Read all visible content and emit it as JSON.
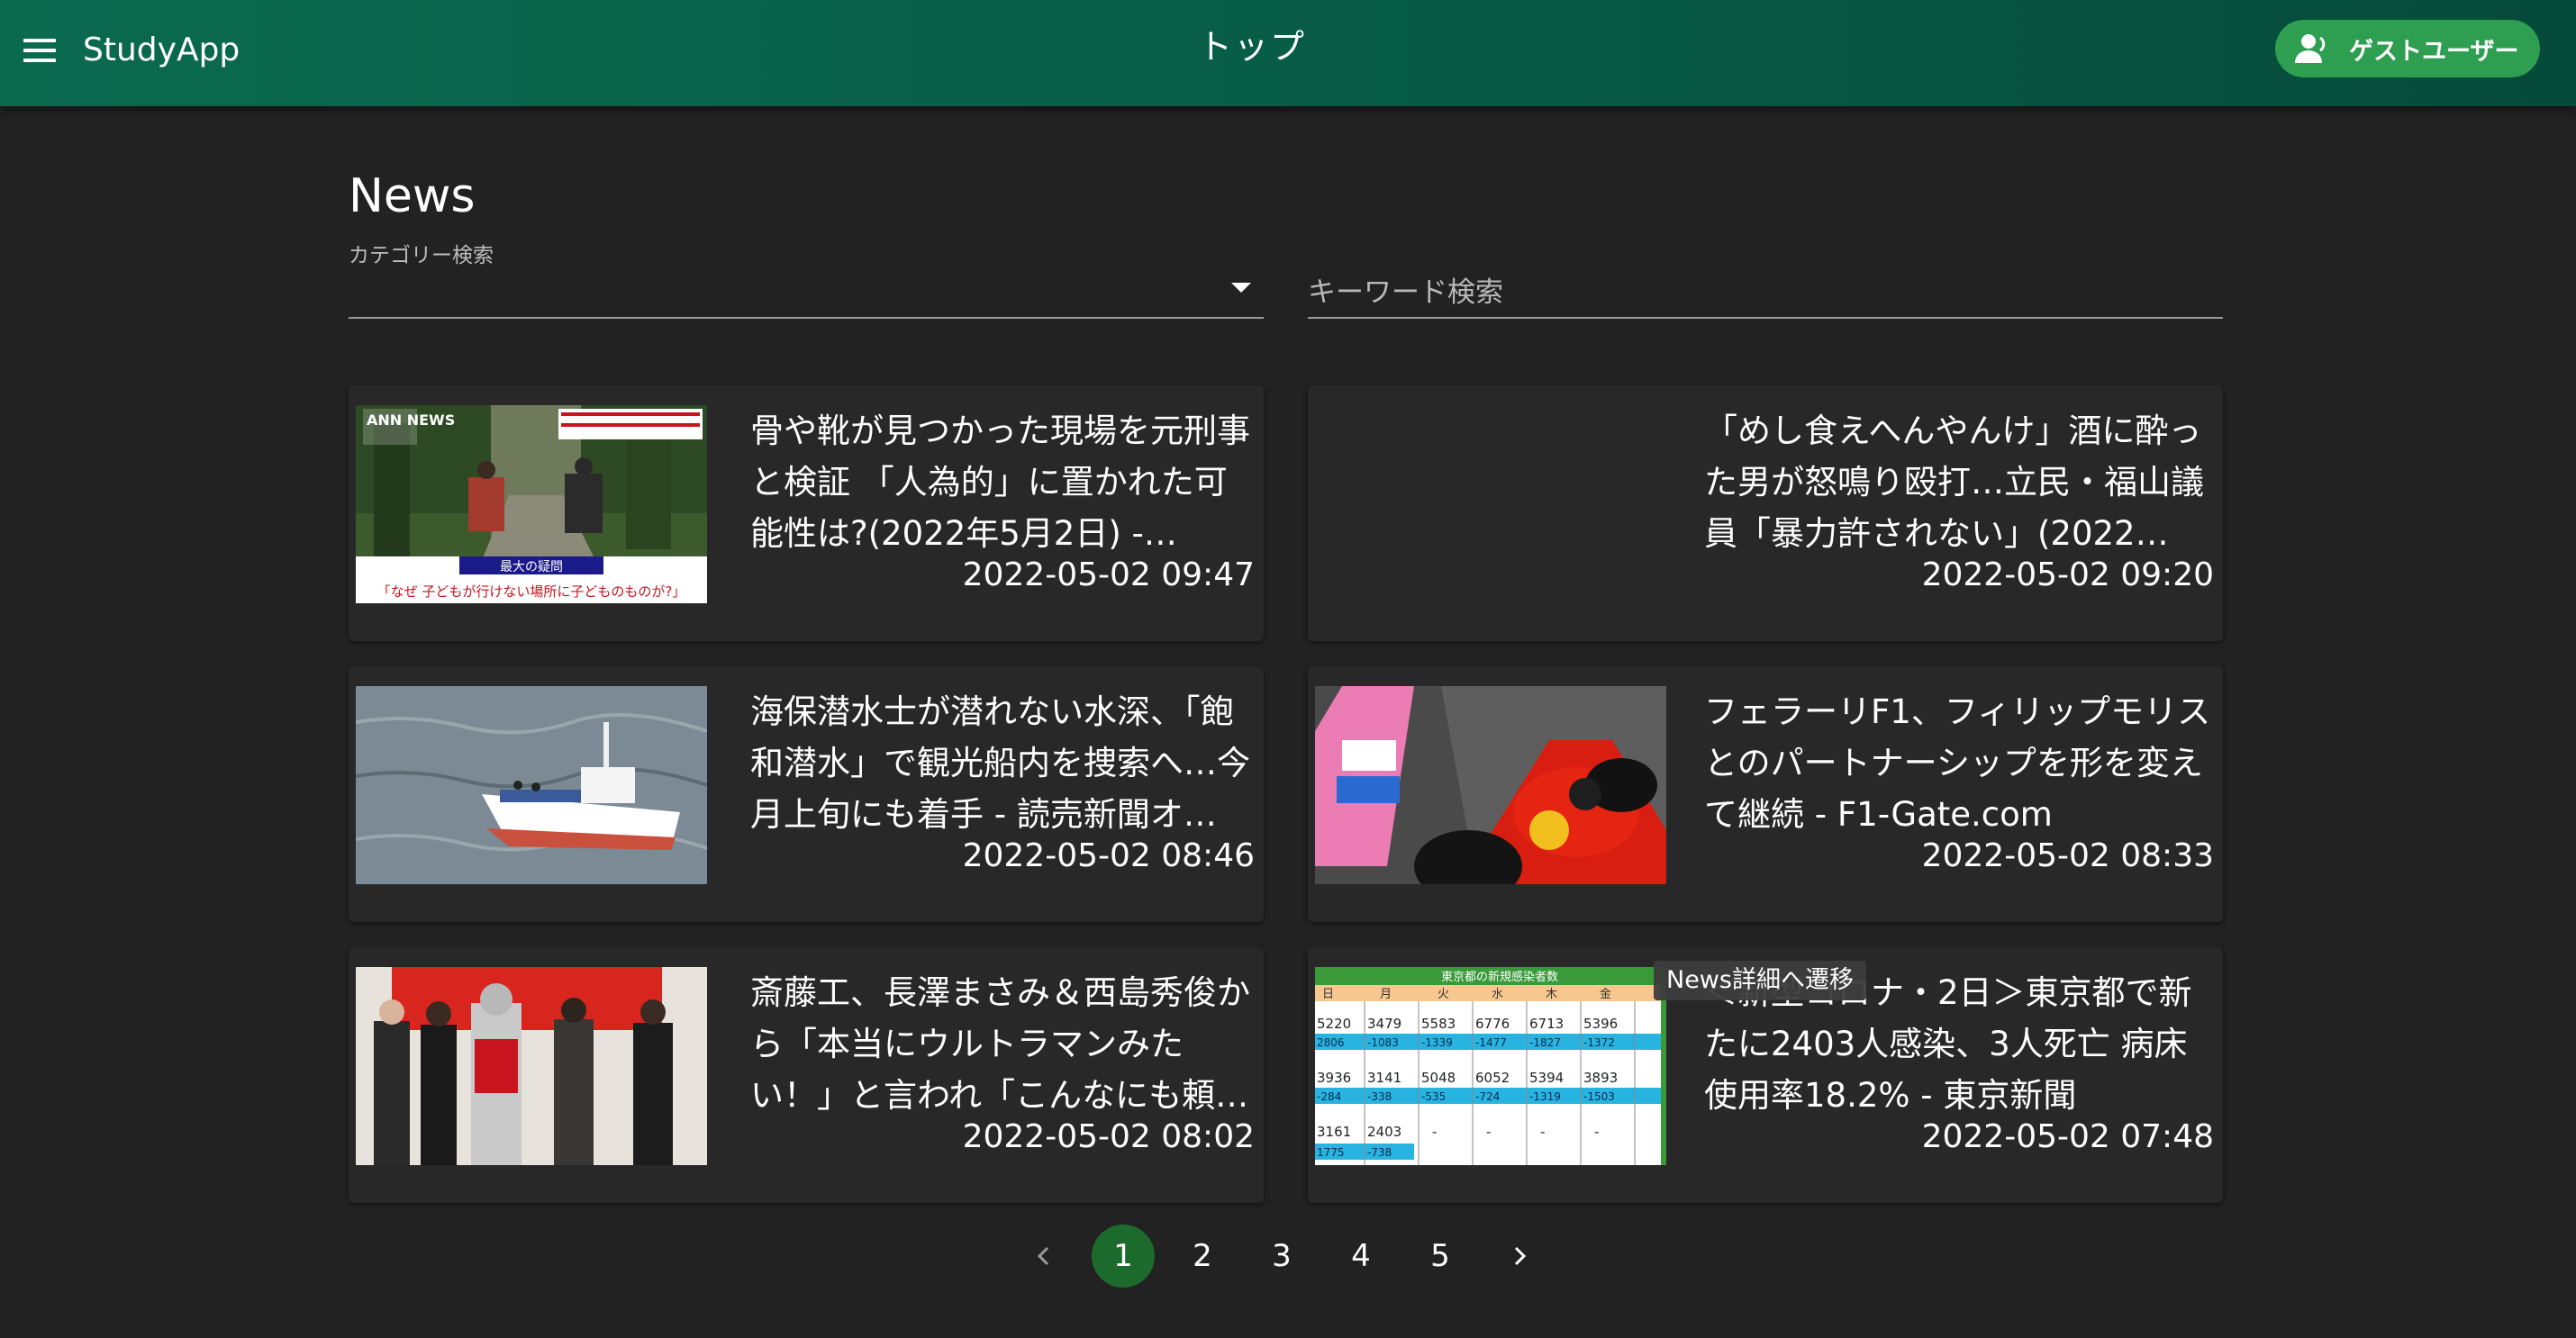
{
  "header": {
    "app_title": "StudyApp",
    "page_title": "トップ",
    "guest_label": "ゲストユーザー",
    "color": "#075a44"
  },
  "news": {
    "heading": "News",
    "category_label": "カテゴリー検索",
    "category_value": "",
    "keyword_placeholder": "キーワード検索"
  },
  "articles": [
    {
      "title": "骨や靴が見つかった現場を元刑事と検証 「人為的」に置かれた可能性は?(2022年5月2日) -…",
      "date": "2022-05-02 09:47",
      "thumb_banner": "最大の疑問",
      "thumb_caption": "「なぜ 子どもが行けない場所に子どものものが?」",
      "thumb_logo": "ANN NEWS"
    },
    {
      "title": "「めし食えへんやんけ」酒に酔った男が怒鳴り殴打…立民・福山議員「暴力許されない」(2022…",
      "date": "2022-05-02 09:20"
    },
    {
      "title": "海保潜水士が潜れない水深、「飽和潜水」で観光船内を捜索へ…今月上旬にも着手 - 読売新聞オ…",
      "date": "2022-05-02 08:46"
    },
    {
      "title": "フェラーリF1、フィリップモリスとのパートナーシップを形を変えて継続 - F1-Gate.com",
      "date": "2022-05-02 08:33"
    },
    {
      "title": "斎藤工、長澤まさみ＆西島秀俊から「本当にウルトラマンみたい！」と言われ「こんなにも頼…",
      "date": "2022-05-02 08:02"
    },
    {
      "title": "＜新型コロナ・2日＞東京都で新たに2403人感染、3人死亡 病床使用率18.2% - 東京新聞",
      "date": "2022-05-02 07:48",
      "thumb_title": "東京都の新規感染者数",
      "thumb_days": [
        "日",
        "月",
        "火",
        "水",
        "木",
        "金"
      ],
      "thumb_row1": [
        "5220",
        "3479",
        "5583",
        "6776",
        "6713",
        "5396"
      ],
      "thumb_row2": [
        "2806",
        "-1083",
        "-1339",
        "-1477",
        "-1827",
        "-1372"
      ],
      "thumb_row3": [
        "3936",
        "3141",
        "5048",
        "6052",
        "5394",
        "3893"
      ],
      "thumb_row4": [
        "-284",
        "-338",
        "-535",
        "-724",
        "-1319",
        "-1503"
      ],
      "thumb_row5": [
        "3161",
        "2403",
        "-",
        "-",
        "-",
        "-"
      ],
      "thumb_row6": [
        "1775",
        "-738",
        "",
        "",
        "",
        ""
      ]
    }
  ],
  "tooltip": "News詳細へ遷移",
  "pagination": {
    "pages": [
      "1",
      "2",
      "3",
      "4",
      "5"
    ],
    "current": "1",
    "accent": "#1d6b2c"
  }
}
